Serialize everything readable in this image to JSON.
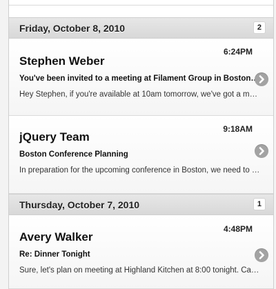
{
  "groups": [
    {
      "date": "Friday, October 8, 2010",
      "count": "2",
      "messages": [
        {
          "sender": "Stephen Weber",
          "time": "6:24PM",
          "subject": "You've been invited to a meeting at Filament Group in Boston, MA",
          "preview": "Hey Stephen, if you're available at 10am tomorrow, we've got a meeting with the jQuery team."
        },
        {
          "sender": "jQuery Team",
          "time": "9:18AM",
          "subject": "Boston Conference Planning",
          "preview": "In preparation for the upcoming conference in Boston, we need to start gathering a list of sponsors and speakers."
        }
      ]
    },
    {
      "date": "Thursday, October 7, 2010",
      "count": "1",
      "messages": [
        {
          "sender": "Avery Walker",
          "time": "4:48PM",
          "subject": "Re: Dinner Tonight",
          "preview": "Sure, let's plan on meeting at Highland Kitchen at 8:00 tonight. Can't wait!"
        }
      ]
    }
  ],
  "icons": {
    "disclosure": "chevron-right-circle-icon"
  },
  "colors": {
    "divider_bg": "#dddddd",
    "arrow_bg": "#a3a3a3"
  }
}
